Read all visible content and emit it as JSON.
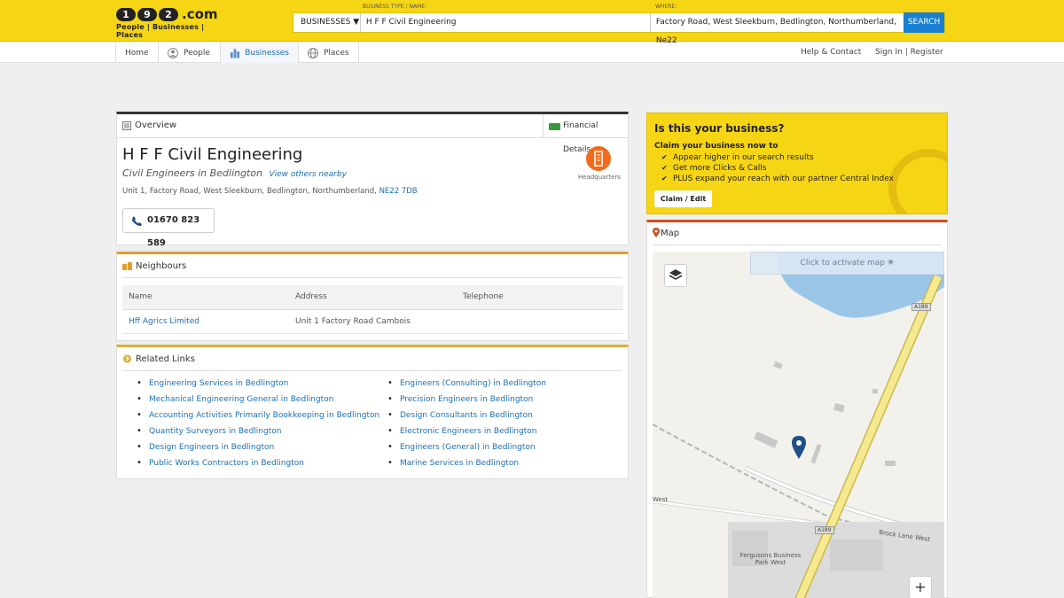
{
  "header": {
    "logo_digits": [
      "1",
      "9",
      "2"
    ],
    "logo_com": ".com",
    "logo_tagline": "People | Businesses | Places",
    "type_label": "BUSINESS TYPE / NAME:",
    "where_label": "WHERE:",
    "type_select": "BUSINESSES ▼",
    "type_value": "H F F Civil Engineering",
    "where_value": "Factory Road, West Sleekburn, Bedlington, Northumberland, Ne22",
    "search_label": "SEARCH"
  },
  "nav": {
    "home": "Home",
    "people": "People",
    "businesses": "Businesses",
    "places": "Places",
    "help": "Help & Contact",
    "signin": "Sign In",
    "sep": "|",
    "register": "Register"
  },
  "overview": {
    "title": "Overview",
    "financial": "Financial Details",
    "name": "H F F Civil Engineering",
    "category": "Civil Engineers in Bedlington",
    "nearby": "View others nearby",
    "address": "Unit 1,  Factory Road,  West Sleekburn,  Bedlington,  Northumberland,",
    "postcode": "NE22 7DB",
    "phone": "01670 823 589",
    "hq_label": "Headquarters"
  },
  "neighbours": {
    "title": "Neighbours",
    "columns": [
      "Name",
      "Address",
      "Telephone"
    ],
    "rows": [
      {
        "name": "Hff Agrics Limited",
        "address": "Unit 1 Factory Road Cambois",
        "telephone": ""
      }
    ]
  },
  "related": {
    "title": "Related Links",
    "left": [
      "Engineering Services in Bedlington",
      "Mechanical Engineering General in Bedlington",
      "Accounting Activities Primarily Bookkeeping in Bedlington",
      "Quantity Surveyors in Bedlington",
      "Design Engineers in Bedlington",
      "Public Works Contractors in Bedlington"
    ],
    "right": [
      "Engineers (Consulting) in Bedlington",
      "Precision Engineers in Bedlington",
      "Design Consultants in Bedlington",
      "Electronic Engineers in Bedlington",
      "Engineers (General) in Bedlington",
      "Marine Services in Bedlington"
    ]
  },
  "claim": {
    "title": "Is this your business?",
    "subtitle": "Claim your business now to",
    "items": [
      "Appear higher in our search results",
      "Get more Clicks & Calls",
      "PLUS expand your reach with our partner Central Index"
    ],
    "button": "Claim / Edit"
  },
  "map": {
    "title": "Map",
    "activate": "Click to activate map",
    "zoom_in": "+",
    "road_badge_1": "A189",
    "road_badge_2": "A189",
    "label_west": "West",
    "label_brock": "Brock Lane West",
    "label_park_1": "Fergusons Business",
    "label_park_2": "Park West"
  },
  "colors": {
    "brand_yellow": "#f6d514",
    "link_blue": "#1a6fb5",
    "search_blue": "#1a7fd0",
    "hq_orange": "#f26b1d"
  }
}
